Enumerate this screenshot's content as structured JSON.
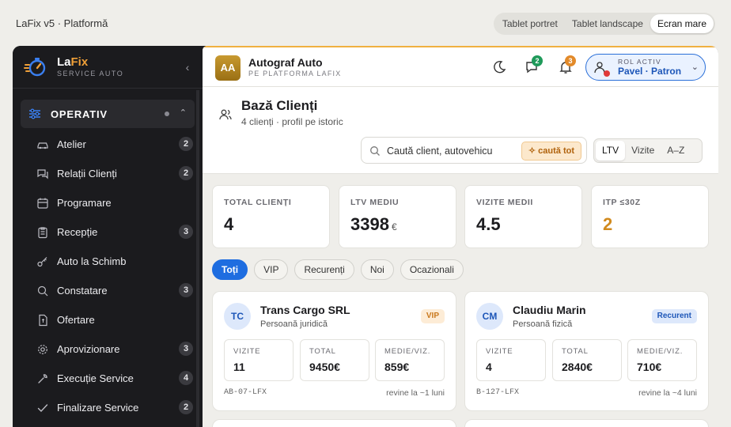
{
  "app": {
    "title": "LaFix v5 · Platformă"
  },
  "view_modes": [
    "Tablet portret",
    "Tablet landscape",
    "Ecran mare"
  ],
  "view_mode_active": "Ecran mare",
  "brand": {
    "name_part1": "La",
    "name_part2": "Fix",
    "subtitle": "SERVICE AUTO"
  },
  "sidebar": {
    "section": {
      "label": "OPERATIV"
    },
    "items": [
      {
        "label": "Atelier",
        "badge": "2",
        "icon": "car-icon"
      },
      {
        "label": "Relații Clienți",
        "badge": "2",
        "icon": "chat-icon"
      },
      {
        "label": "Programare",
        "badge": "",
        "icon": "calendar-icon"
      },
      {
        "label": "Recepție",
        "badge": "3",
        "icon": "clipboard-icon"
      },
      {
        "label": "Auto la Schimb",
        "badge": "",
        "icon": "key-icon"
      },
      {
        "label": "Constatare",
        "badge": "3",
        "icon": "magnifier-icon"
      },
      {
        "label": "Ofertare",
        "badge": "",
        "icon": "document-icon"
      },
      {
        "label": "Aprovizionare",
        "badge": "3",
        "icon": "gear-icon"
      },
      {
        "label": "Execuție Service",
        "badge": "4",
        "icon": "wrench-icon"
      },
      {
        "label": "Finalizare Service",
        "badge": "2",
        "icon": "check-icon"
      }
    ]
  },
  "workspace": {
    "initials": "AA",
    "name": "Autograf Auto",
    "subtitle": "PE PLATFORMA LAFIX"
  },
  "header_badges": {
    "messages": "2",
    "notifications": "3"
  },
  "role": {
    "label": "ROL ACTIV",
    "name": "Pavel · Patron"
  },
  "page": {
    "title": "Bază Clienți",
    "subtitle": "4 clienți · profil pe istoric"
  },
  "search": {
    "placeholder": "Caută client, autovehicu",
    "all_label": "✧ caută tot"
  },
  "sort_options": [
    "LTV",
    "Vizite",
    "A–Z"
  ],
  "sort_active": "LTV",
  "stats": [
    {
      "label": "TOTAL CLIENȚI",
      "value": "4",
      "unit": ""
    },
    {
      "label": "LTV MEDIU",
      "value": "3398",
      "unit": "€"
    },
    {
      "label": "VIZITE MEDII",
      "value": "4.5",
      "unit": ""
    },
    {
      "label": "ITP ≤30Z",
      "value": "2",
      "unit": ""
    }
  ],
  "filters": [
    "Toți",
    "VIP",
    "Recurenți",
    "Noi",
    "Ocazionali"
  ],
  "filter_active": "Toți",
  "clients": [
    {
      "initials": "TC",
      "name": "Trans Cargo SRL",
      "type": "Persoană juridică",
      "tag": "VIP",
      "metrics": [
        {
          "label": "VIZITE",
          "value": "11"
        },
        {
          "label": "TOTAL",
          "value": "9450€"
        },
        {
          "label": "MEDIE/VIZ.",
          "value": "859€"
        }
      ],
      "plate": "AB-07-LFX",
      "return": "revine la ~1 luni"
    },
    {
      "initials": "CM",
      "name": "Claudiu Marin",
      "type": "Persoană fizică",
      "tag": "Recurent",
      "metrics": [
        {
          "label": "VIZITE",
          "value": "4"
        },
        {
          "label": "TOTAL",
          "value": "2840€"
        },
        {
          "label": "MEDIE/VIZ.",
          "value": "710€"
        }
      ],
      "plate": "B-127-LFX",
      "return": "revine la ~4 luni"
    }
  ],
  "colors": {
    "accent": "#f0a038",
    "primary": "#1e6de0",
    "itp": "#d18a1e",
    "sidebar_bg": "#1b1b1e"
  }
}
